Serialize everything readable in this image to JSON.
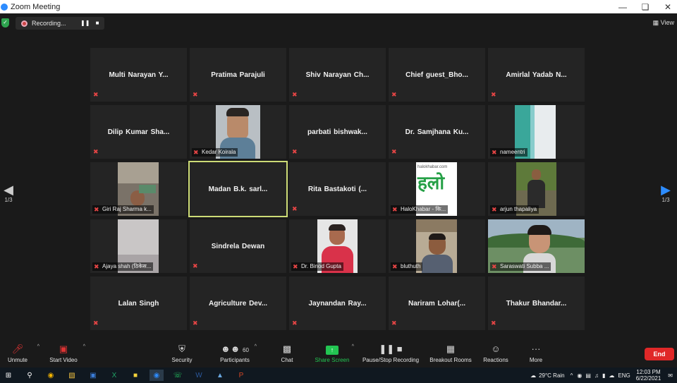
{
  "window": {
    "title": "Zoom Meeting",
    "controls": [
      "minimize-icon",
      "maximize-icon",
      "close-icon"
    ]
  },
  "recording": {
    "label": "Recording..."
  },
  "view": {
    "label": "View"
  },
  "pager": {
    "left": "1/3",
    "right": "1/3"
  },
  "participants_grid": [
    {
      "name": "Multi Narayan Y...",
      "muted": true,
      "video": false
    },
    {
      "name": "Pratima Parajuli",
      "muted": true,
      "video": false
    },
    {
      "name": "Shiv Narayan Ch...",
      "muted": true,
      "video": false
    },
    {
      "name": "Chief guest_Bho...",
      "muted": true,
      "video": false
    },
    {
      "name": "Amirlal Yadab N...",
      "muted": true,
      "video": false
    },
    {
      "name": "Dilip Kumar Sha...",
      "muted": true,
      "video": false
    },
    {
      "name": "Kedar Koirala",
      "muted": true,
      "video": true
    },
    {
      "name": "parbati bishwak...",
      "muted": true,
      "video": false
    },
    {
      "name": "Dr. Samjhana Ku...",
      "muted": true,
      "video": false
    },
    {
      "name": "nameentri",
      "muted": true,
      "video": true
    },
    {
      "name": "Giri Raj Sharma k...",
      "muted": true,
      "video": true
    },
    {
      "name": "Madan B.k. sarl...",
      "muted": false,
      "video": false,
      "active_speaker": true
    },
    {
      "name": "Rita Bastakoti (...",
      "muted": true,
      "video": false
    },
    {
      "name": "HaloKhabar - कि...",
      "muted": true,
      "video": true
    },
    {
      "name": "arjun thapaliya",
      "muted": true,
      "video": true
    },
    {
      "name": "Ajaya shah (ठिकेस...",
      "muted": true,
      "video": true
    },
    {
      "name": "Sindrela Dewan",
      "muted": true,
      "video": false
    },
    {
      "name": "Dr. Binod Gupta",
      "muted": true,
      "video": true
    },
    {
      "name": "bluthuth",
      "muted": true,
      "video": true
    },
    {
      "name": "Saraswati Subba ...",
      "muted": true,
      "video": true
    },
    {
      "name": "Lalan Singh",
      "muted": true,
      "video": false
    },
    {
      "name": "Agriculture Dev...",
      "muted": true,
      "video": false
    },
    {
      "name": "Jaynandan Ray...",
      "muted": true,
      "video": false
    },
    {
      "name": "Nariram Lohar(...",
      "muted": true,
      "video": false
    },
    {
      "name": "Thakur Bhandar...",
      "muted": true,
      "video": false
    }
  ],
  "halokhabar": {
    "site": "halokhabar.com",
    "glyph": "हलो"
  },
  "toolbar": {
    "unmute": "Unmute",
    "start_video": "Start Video",
    "security": "Security",
    "participants": "Participants",
    "participants_count": "60",
    "chat": "Chat",
    "share_screen": "Share Screen",
    "pause_recording": "Pause/Stop Recording",
    "breakout": "Breakout Rooms",
    "reactions": "Reactions",
    "more": "More",
    "end": "End"
  },
  "taskbar": {
    "weather": "29°C  Rain",
    "lang": "ENG",
    "time": "12:03 PM",
    "date": "6/22/2021"
  },
  "colors": {
    "active_border": "#cddc76",
    "muted": "#e54545",
    "share": "#23c552",
    "end": "#e02828"
  }
}
